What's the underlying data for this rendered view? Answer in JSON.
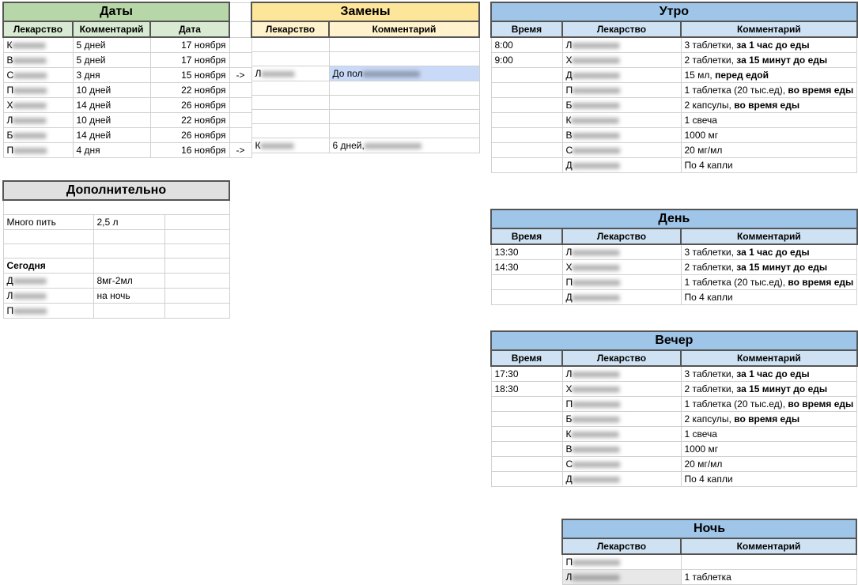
{
  "dates": {
    "title": "Даты",
    "headers": [
      "Лекарство",
      "Комментарий",
      "Дата"
    ],
    "rows": [
      {
        "med": "К",
        "comment": "5 дней",
        "date": "17 ноября",
        "arrow": ""
      },
      {
        "med": "В",
        "comment": "5 дней",
        "date": "17 ноября",
        "arrow": ""
      },
      {
        "med": "С",
        "comment": "3 дня",
        "date": "15 ноября",
        "arrow": "->"
      },
      {
        "med": "П",
        "comment": "10 дней",
        "date": "22 ноября",
        "arrow": ""
      },
      {
        "med": "Х",
        "comment": "14 дней",
        "date": "26 ноября",
        "arrow": ""
      },
      {
        "med": "Л",
        "comment": "10 дней",
        "date": "22 ноября",
        "arrow": ""
      },
      {
        "med": "Б",
        "comment": "14 дней",
        "date": "26 ноября",
        "arrow": ""
      },
      {
        "med": "П",
        "comment": "4 дня",
        "date": "16 ноября",
        "arrow": "->"
      }
    ]
  },
  "replacements": {
    "title": "Замены",
    "headers": [
      "Лекарство",
      "Комментарий"
    ],
    "rows": [
      {
        "med": "",
        "comment": ""
      },
      {
        "med": "",
        "comment": ""
      },
      {
        "med": "Л",
        "comment": "До пол",
        "sel": true
      },
      {
        "med": "",
        "comment": ""
      },
      {
        "med": "",
        "comment": ""
      },
      {
        "med": "",
        "comment": ""
      },
      {
        "med": "",
        "comment": ""
      },
      {
        "med": "К",
        "comment": "6 дней,"
      }
    ]
  },
  "extra": {
    "title": "Дополнительно",
    "row1": {
      "a": "Много пить",
      "b": "2,5 л"
    },
    "today_label": "Сегодня",
    "today_rows": [
      {
        "med": "Д",
        "comment": "8мг-2мл"
      },
      {
        "med": "Л",
        "comment": "на ночь"
      },
      {
        "med": "П",
        "comment": ""
      }
    ]
  },
  "morning": {
    "title": "Утро",
    "headers": [
      "Время",
      "Лекарство",
      "Комментарий"
    ],
    "rows": [
      {
        "time": "8:00",
        "med": "Л",
        "comment": "3 таблетки, ",
        "bold": "за 1 час до еды"
      },
      {
        "time": "9:00",
        "med": "Х",
        "comment": "2 таблетки, ",
        "bold": "за 15 минут до еды"
      },
      {
        "time": "",
        "med": "Д",
        "comment": "15 мл, ",
        "bold": "перед едой"
      },
      {
        "time": "",
        "med": "П",
        "comment": "1 таблетка (20 тыс.ед), ",
        "bold": "во время еды"
      },
      {
        "time": "",
        "med": "Б",
        "comment": "2 капсулы, ",
        "bold": "во время еды"
      },
      {
        "time": "",
        "med": "К",
        "comment": "1 свеча",
        "bold": ""
      },
      {
        "time": "",
        "med": "В",
        "comment": "1000 мг",
        "bold": ""
      },
      {
        "time": "",
        "med": "С",
        "comment": "20 мг/мл",
        "bold": ""
      },
      {
        "time": "",
        "med": "Д",
        "comment": "По 4 капли",
        "bold": ""
      }
    ]
  },
  "day": {
    "title": "День",
    "headers": [
      "Время",
      "Лекарство",
      "Комментарий"
    ],
    "rows": [
      {
        "time": "13:30",
        "med": "Л",
        "comment": "3 таблетки, ",
        "bold": "за 1 час до еды"
      },
      {
        "time": "14:30",
        "med": "Х",
        "comment": "2 таблетки, ",
        "bold": "за 15 минут до еды"
      },
      {
        "time": "",
        "med": "П",
        "comment": "1 таблетка (20 тыс.ед), ",
        "bold": "во время еды"
      },
      {
        "time": "",
        "med": "Д",
        "comment": "По 4 капли",
        "bold": ""
      }
    ]
  },
  "evening": {
    "title": "Вечер",
    "headers": [
      "Время",
      "Лекарство",
      "Комментарий"
    ],
    "rows": [
      {
        "time": "17:30",
        "med": "Л",
        "comment": "3 таблетки, ",
        "bold": "за 1 час до еды"
      },
      {
        "time": "18:30",
        "med": "Х",
        "comment": "2 таблетки, ",
        "bold": "за 15 минут до еды"
      },
      {
        "time": "",
        "med": "П",
        "comment": "1 таблетка (20 тыс.ед), ",
        "bold": "во время еды"
      },
      {
        "time": "",
        "med": "Б",
        "comment": "2 капсулы, ",
        "bold": "во время еды"
      },
      {
        "time": "",
        "med": "К",
        "comment": "1 свеча",
        "bold": ""
      },
      {
        "time": "",
        "med": "В",
        "comment": "1000 мг",
        "bold": ""
      },
      {
        "time": "",
        "med": "С",
        "comment": "20 мг/мл",
        "bold": ""
      },
      {
        "time": "",
        "med": "Д",
        "comment": "По 4 капли",
        "bold": ""
      }
    ]
  },
  "night": {
    "title": "Ночь",
    "headers": [
      "Лекарство",
      "Комментарий"
    ],
    "rows": [
      {
        "med": "П",
        "comment": ""
      },
      {
        "med": "Л",
        "comment": "1 таблетка"
      }
    ]
  }
}
